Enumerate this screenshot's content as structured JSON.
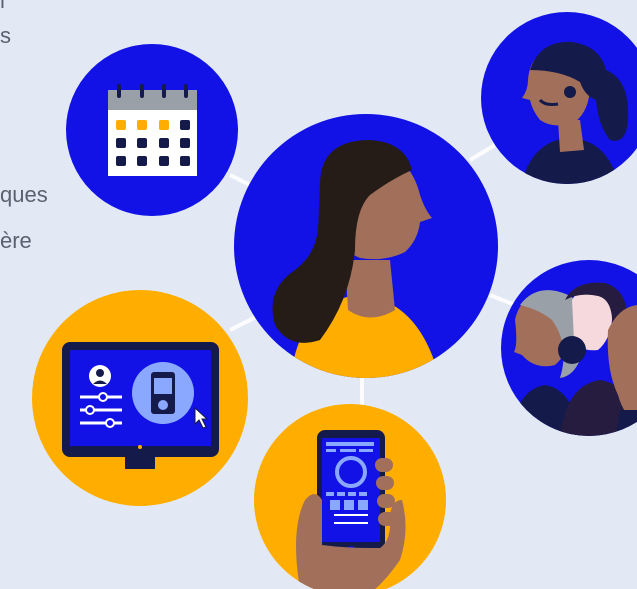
{
  "text_fragments": [
    "l",
    "s",
    "ques",
    "ère"
  ],
  "colors": {
    "background": "#e2e9f5",
    "blue": "#1212e6",
    "yellow": "#ffae00",
    "navy": "#141a4a",
    "skin": "#a2705a",
    "hair": "#251c17"
  },
  "illustrations": [
    "calendar-icon",
    "agent-headset-portrait",
    "woman-profile-portrait",
    "group-profiles",
    "monitor-dashboard",
    "smartphone-in-hand"
  ]
}
